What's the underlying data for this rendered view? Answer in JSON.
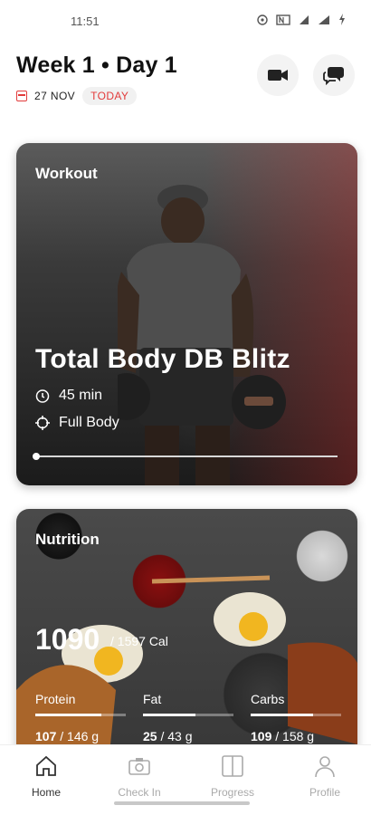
{
  "status_bar": {
    "time": "11:51",
    "icons": [
      "hotspot-icon",
      "nfc-icon",
      "signal-icon",
      "wifi-icon",
      "battery-charging-icon"
    ]
  },
  "header": {
    "title": "Week 1 • Day 1",
    "date": "27 NOV",
    "today_badge": "TODAY",
    "accent_color": "#e23b3b"
  },
  "workout_card": {
    "label": "Workout",
    "title": "Total Body DB Blitz",
    "duration": "45 min",
    "focus": "Full Body",
    "progress": 0
  },
  "nutrition_card": {
    "label": "Nutrition",
    "calories": "1090",
    "calories_goal": "/ 1597 Cal",
    "macros": [
      {
        "name": "Protein",
        "current": "107",
        "goal": " / 146 g",
        "fraction": 0.73
      },
      {
        "name": "Fat",
        "current": "25",
        "goal": " / 43 g",
        "fraction": 0.58
      },
      {
        "name": "Carbs",
        "current": "109",
        "goal": " / 158 g",
        "fraction": 0.69
      }
    ]
  },
  "bottom_nav": {
    "tabs": [
      {
        "label": "Home",
        "icon": "home-icon",
        "active": true
      },
      {
        "label": "Check In",
        "icon": "camera-icon",
        "active": false
      },
      {
        "label": "Progress",
        "icon": "progress-icon",
        "active": false
      },
      {
        "label": "Profile",
        "icon": "profile-icon",
        "active": false
      }
    ]
  }
}
